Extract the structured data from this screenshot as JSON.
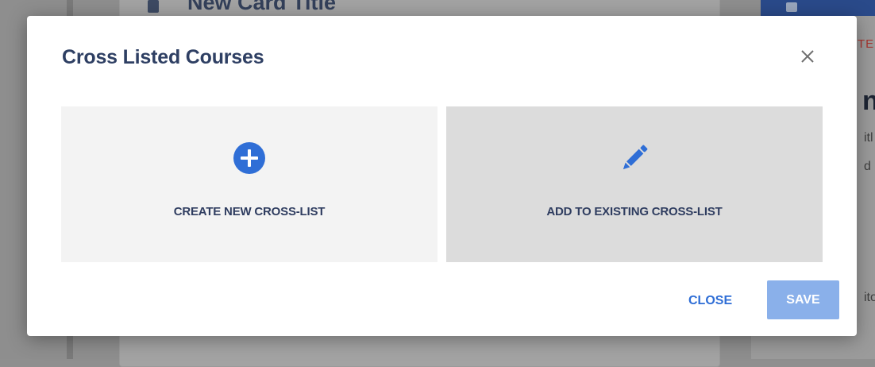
{
  "background": {
    "card_title": "New Card Title",
    "right_red_fragment": "TE",
    "fragment_big": "nt",
    "fragment_1": "itl",
    "fragment_2": "d C",
    "fragment_3": "ito"
  },
  "modal": {
    "title": "Cross Listed Courses",
    "options": [
      {
        "label": "CREATE NEW CROSS-LIST",
        "icon": "plus-circle-icon"
      },
      {
        "label": "ADD TO EXISTING CROSS-LIST",
        "icon": "pencil-icon"
      }
    ],
    "close_label": "CLOSE",
    "save_label": "SAVE"
  },
  "colors": {
    "title": "#2e3f63",
    "accent": "#2f6ed6",
    "save_disabled": "#8ab0ea",
    "option_create_bg": "#f3f3f3",
    "option_existing_bg": "#dcdcdc"
  }
}
